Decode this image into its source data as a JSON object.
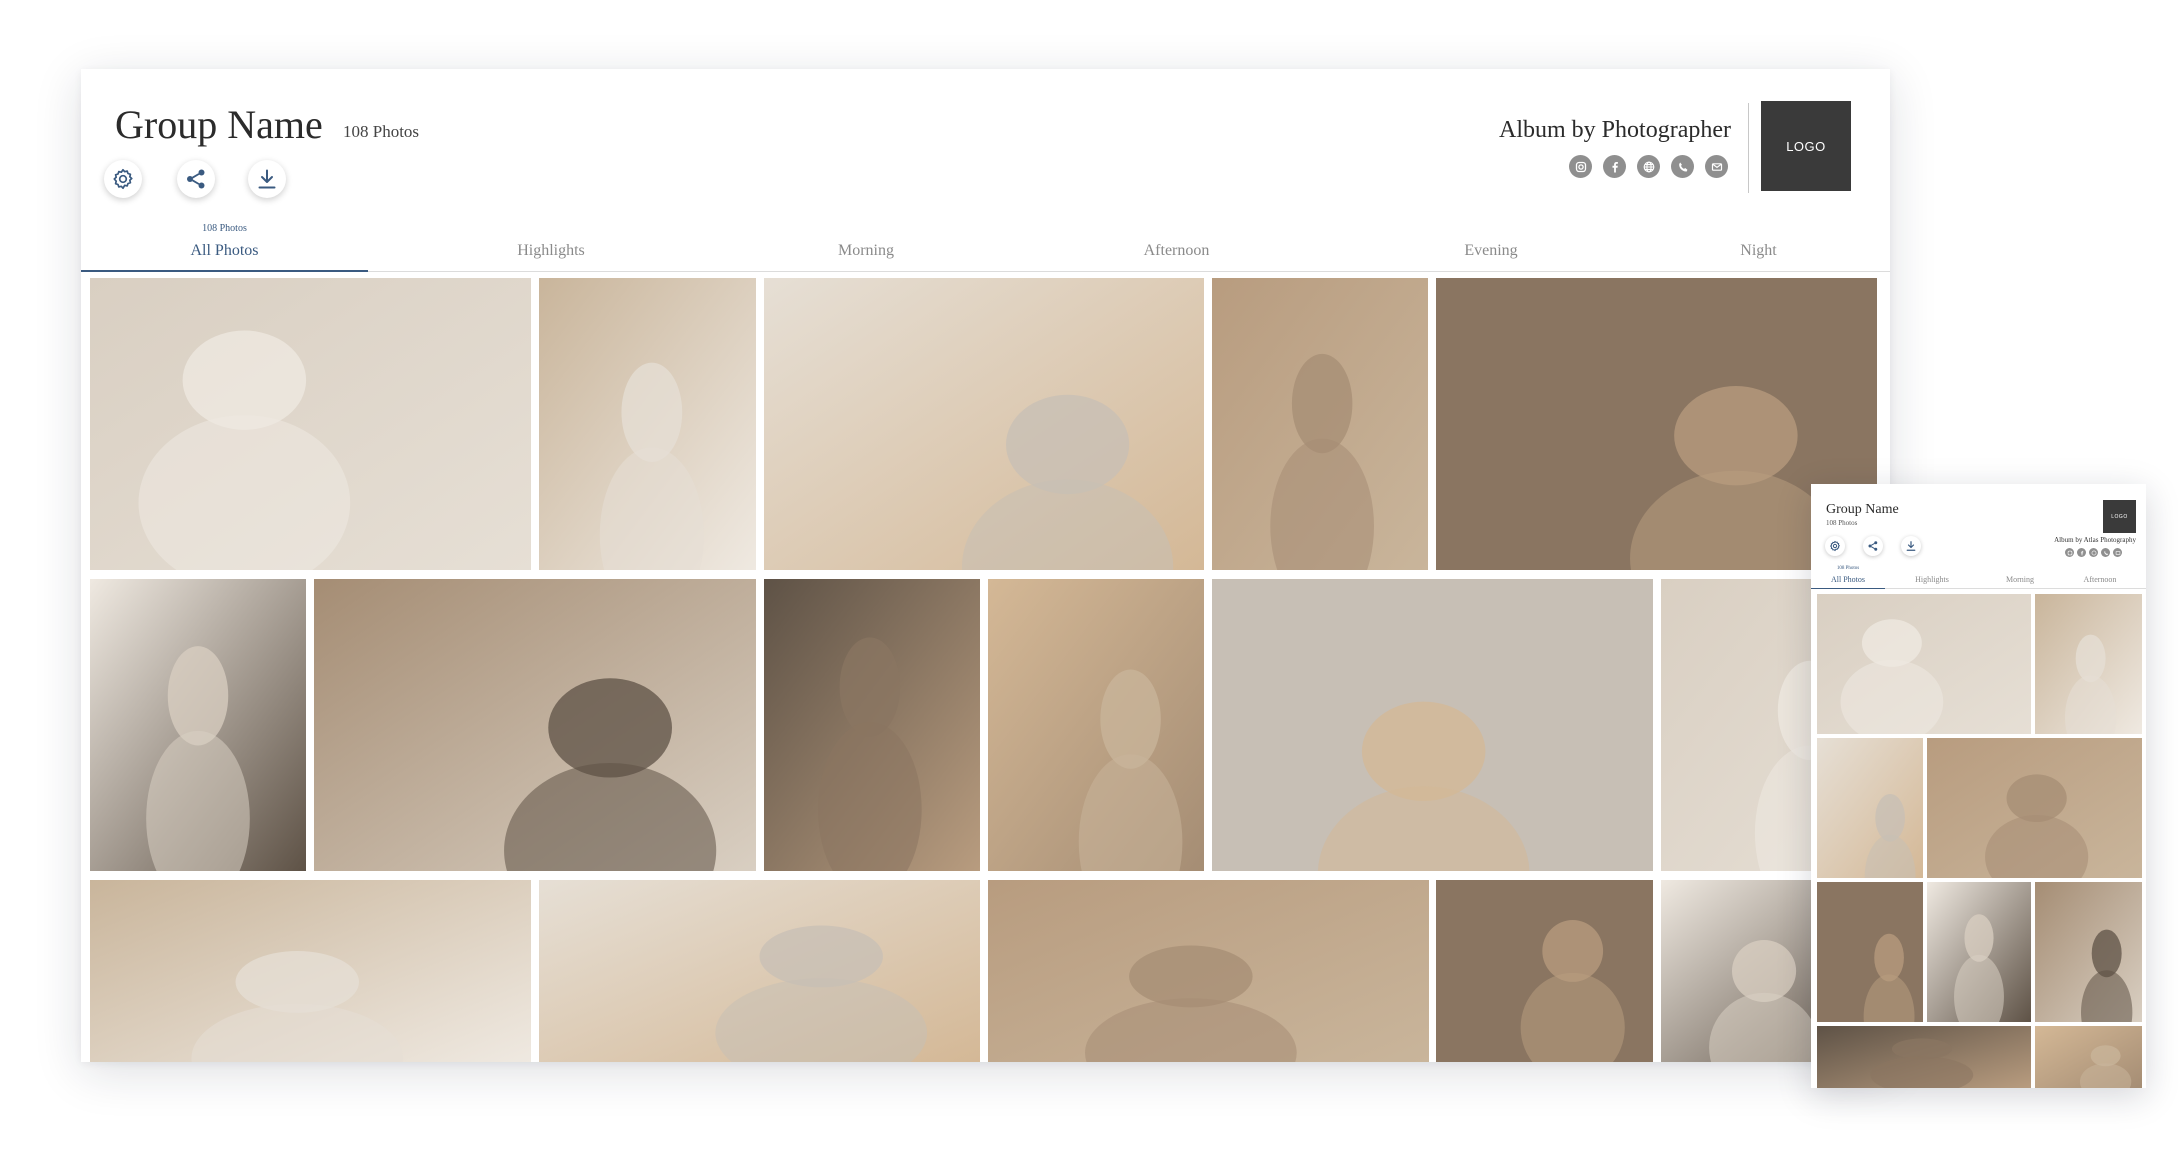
{
  "desktop": {
    "group_name": "Group Name",
    "photo_count": "108 Photos",
    "actions": [
      {
        "icon": "gear-icon",
        "label": "Settings"
      },
      {
        "icon": "share-icon",
        "label": "Share"
      },
      {
        "icon": "download-icon",
        "label": "Download"
      }
    ],
    "album_by": "Album by Photographer",
    "social_icons": [
      "instagram-icon",
      "facebook-icon",
      "website-icon",
      "phone-icon",
      "email-icon"
    ],
    "logo_text": "LOGO",
    "tabs": [
      {
        "label": "All Photos",
        "sub": "108 Photos",
        "active": true
      },
      {
        "label": "Highlights",
        "sub": "",
        "active": false
      },
      {
        "label": "Morning",
        "sub": "",
        "active": false
      },
      {
        "label": "Afternoon",
        "sub": "",
        "active": false
      },
      {
        "label": "Evening",
        "sub": "",
        "active": false
      },
      {
        "label": "Night",
        "sub": "",
        "active": false
      }
    ]
  },
  "mobile": {
    "group_name": "Group Name",
    "photo_count": "108 Photos",
    "album_by": "Album by Atlas Photography",
    "logo_text": "LOGO",
    "tabs": [
      {
        "label": "All Photos",
        "sub": "108 Photos",
        "active": true
      },
      {
        "label": "Highlights",
        "sub": "",
        "active": false
      },
      {
        "label": "Morning",
        "sub": "",
        "active": false
      },
      {
        "label": "Afternoon",
        "sub": "",
        "active": false
      }
    ]
  },
  "colors": {
    "accent": "#3a5a80",
    "logo_bg": "#3a3a3a",
    "social_icon": "#8f8f8f",
    "tab_inactive": "#8a8a8a",
    "photo_palette": [
      "#d9cfc2",
      "#c9b59b",
      "#e6dfd5",
      "#b89c7f",
      "#8a7561",
      "#efe9e1",
      "#a58d74",
      "#5e5246",
      "#d4b896",
      "#c7bfb5"
    ]
  }
}
